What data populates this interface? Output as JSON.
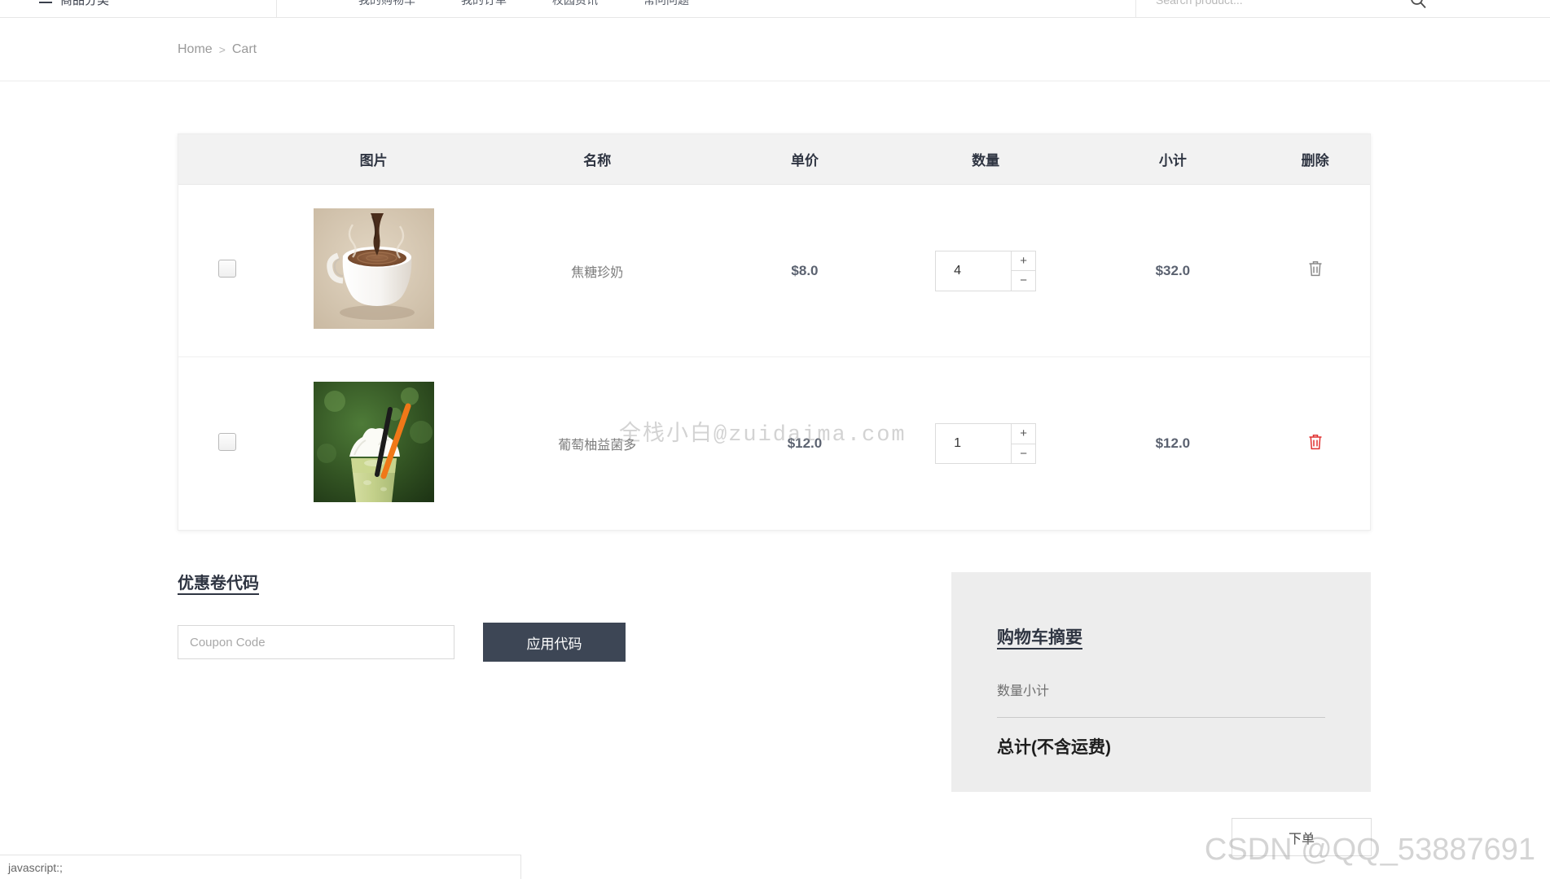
{
  "topnav": {
    "category_label": "商品分类",
    "links": [
      {
        "label": "我的购物车"
      },
      {
        "label": "我的订单"
      },
      {
        "label": "校园资讯"
      },
      {
        "label": "常问问题"
      }
    ],
    "search": {
      "placeholder": "Search product...",
      "value": "",
      "icon": "search-icon"
    }
  },
  "breadcrumb": {
    "home": "Home",
    "separator": ">",
    "current": "Cart"
  },
  "cart_table": {
    "headers": {
      "select": "",
      "image": "图片",
      "name": "名称",
      "unit_price": "单价",
      "quantity": "数量",
      "subtotal": "小计",
      "remove": "删除"
    },
    "rows": [
      {
        "selected": false,
        "image_alt": "焦糖珍奶商品图",
        "name": "焦糖珍奶",
        "unit_price": "$8.0",
        "quantity": "4",
        "subtotal": "$32.0",
        "increment_label": "+",
        "decrement_label": "−",
        "delete_icon": "trash-icon",
        "delete_color": "#8a8a8a"
      },
      {
        "selected": false,
        "image_alt": "葡萄柚益菌多商品图",
        "name": "葡萄柚益菌多",
        "unit_price": "$12.0",
        "quantity": "1",
        "subtotal": "$12.0",
        "increment_label": "+",
        "decrement_label": "−",
        "delete_icon": "trash-icon",
        "delete_color": "#e03131"
      }
    ]
  },
  "coupon": {
    "title": "优惠卷代码",
    "placeholder": "Coupon Code",
    "value": "",
    "apply_label": "应用代码"
  },
  "summary": {
    "title": "购物车摘要",
    "subtotal_label": "数量小计",
    "subtotal_value": "",
    "total_label": "总计(不含运费)",
    "total_value": "",
    "order_button": "下单"
  },
  "statusbar": {
    "text": "javascript:;"
  },
  "watermarks": {
    "center": "全栈小白@zuidaima.com",
    "corner": "CSDN @QQ_53887691"
  },
  "colors": {
    "header_bg": "#f2f2f2",
    "summary_bg": "#ededed",
    "apply_button": "#3d4655",
    "text_dark": "#2f3542",
    "danger": "#e03131"
  }
}
